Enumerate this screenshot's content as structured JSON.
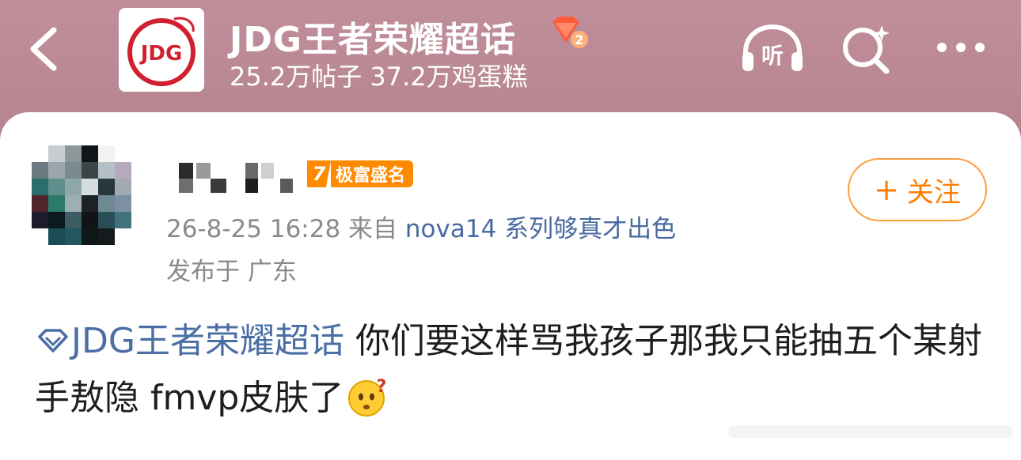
{
  "header": {
    "back_icon": "chevron-left-icon",
    "title": "JDG王者荣耀超话",
    "stats": "25.2万帖子 37.2万鸡蛋糕",
    "listen_label": "听",
    "search_icon": "search-sparkle-icon",
    "more_icon": "more-dots-icon",
    "badge_icon": "diamond-level-2-icon",
    "logo_text": "JDG"
  },
  "post": {
    "author_badge_level": "7",
    "author_badge_text": "极富盛名",
    "follow_label": "关注",
    "timestamp": "26-8-25 16:28",
    "source_prefix": "来自",
    "source": "nova14 系列够真才出色",
    "location": "发布于 广东",
    "topic": "JDG王者荣耀超话",
    "body": "你们要这样骂我孩子那我只能抽五个某射手敖隐 fmvp皮肤了",
    "emoji": "thinking-face-question-emoji"
  },
  "colors": {
    "header_bg": "#b8828e",
    "follow_accent": "#ff7e00",
    "link_blue": "#4b6fa5",
    "badge_orange": "#ff8a00"
  }
}
